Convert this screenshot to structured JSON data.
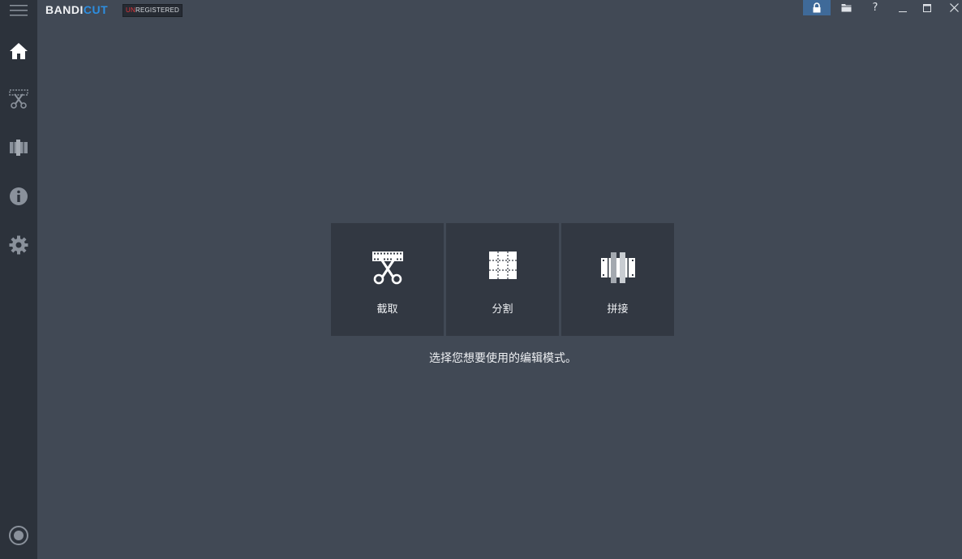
{
  "app": {
    "logo_part1": "BANDI",
    "logo_part2": "CUT",
    "badge_un": "UN",
    "badge_rest": "REGISTERED"
  },
  "window_controls": {
    "help_label": "?",
    "minimize_label": "_",
    "maximize_label": "□",
    "close_label": "✕"
  },
  "sidebar": {
    "items": [
      {
        "icon": "home-icon"
      },
      {
        "icon": "trim-icon"
      },
      {
        "icon": "join-icon"
      },
      {
        "icon": "info-icon"
      },
      {
        "icon": "gear-icon"
      }
    ],
    "bottom_icon": "record-icon"
  },
  "modes": [
    {
      "label": "截取",
      "icon": "scissors-film-icon"
    },
    {
      "label": "分割",
      "icon": "split-grid-icon"
    },
    {
      "label": "拼接",
      "icon": "merge-film-icon"
    }
  ],
  "hint_text": "选择您想要使用的编辑模式。",
  "colors": {
    "background": "#414955",
    "sidebar": "#2c323b",
    "card": "#323842",
    "accent": "#2d8ee0",
    "active_button": "#3f6a99",
    "badge_red": "#e0363b"
  }
}
